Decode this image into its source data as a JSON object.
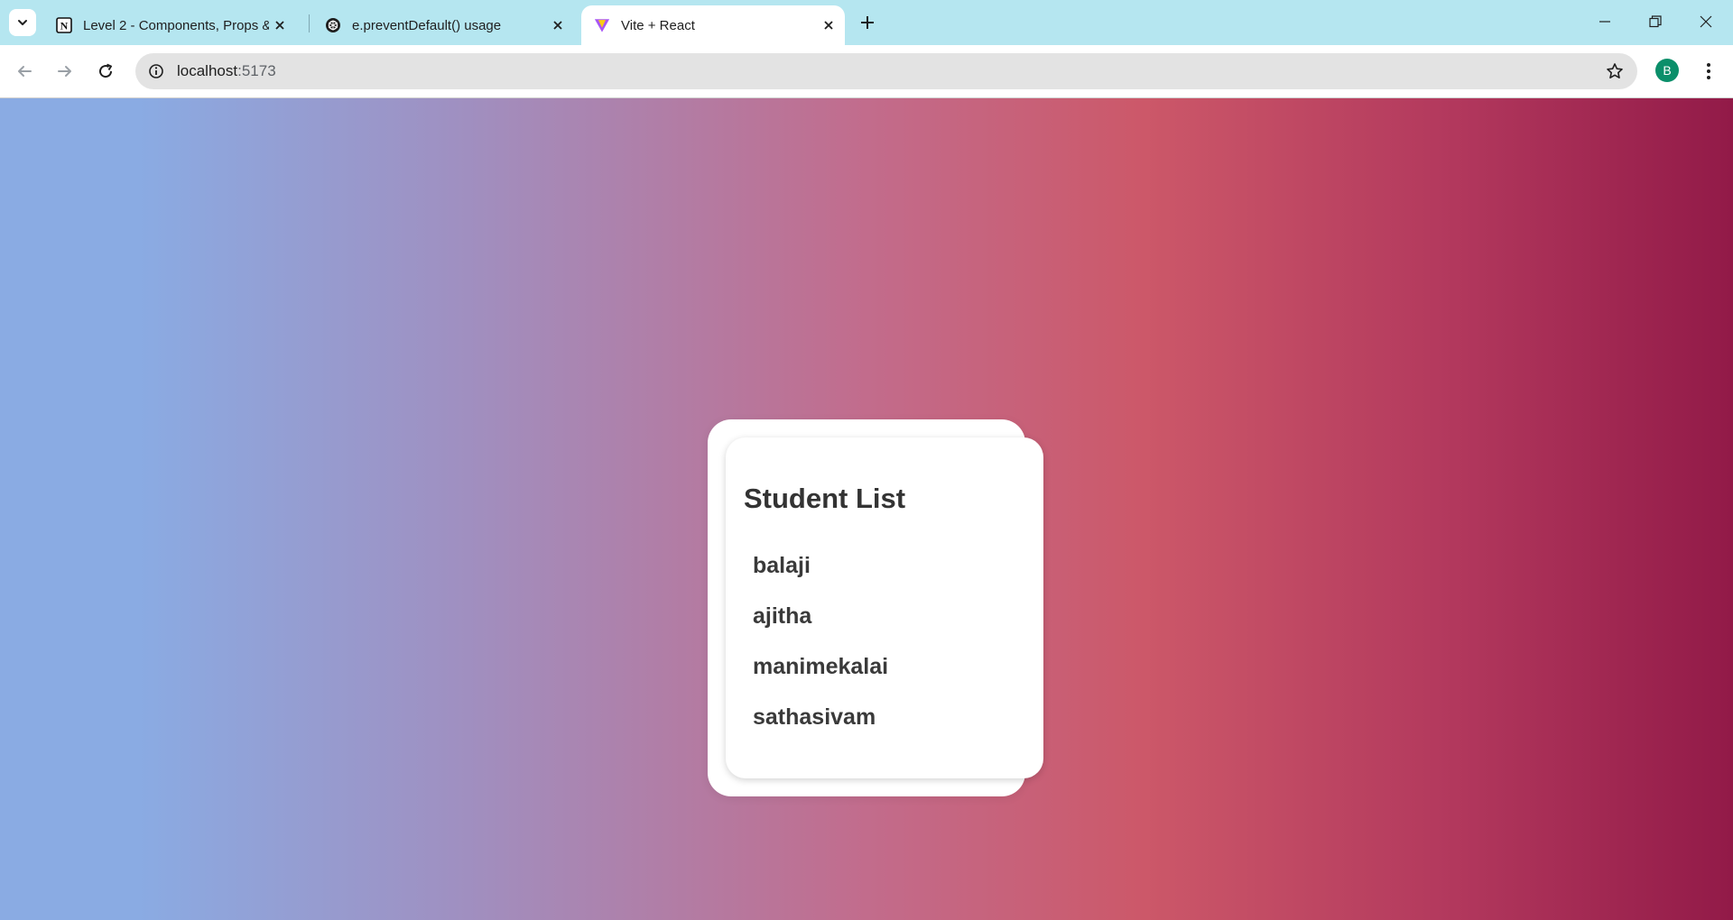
{
  "browser": {
    "tabs": [
      {
        "title": "Level 2 - Components, Props &",
        "favicon": "notion-icon",
        "active": false
      },
      {
        "title": "e.preventDefault() usage",
        "favicon": "chatgpt-icon",
        "active": false
      },
      {
        "title": "Vite + React",
        "favicon": "vite-icon",
        "active": true
      }
    ],
    "address": {
      "host": "localhost",
      "port": ":5173"
    },
    "profile_initial": "B"
  },
  "page": {
    "title": "Student List",
    "students": [
      "balaji",
      "ajitha",
      "manimekalai",
      "sathasivam"
    ]
  }
}
